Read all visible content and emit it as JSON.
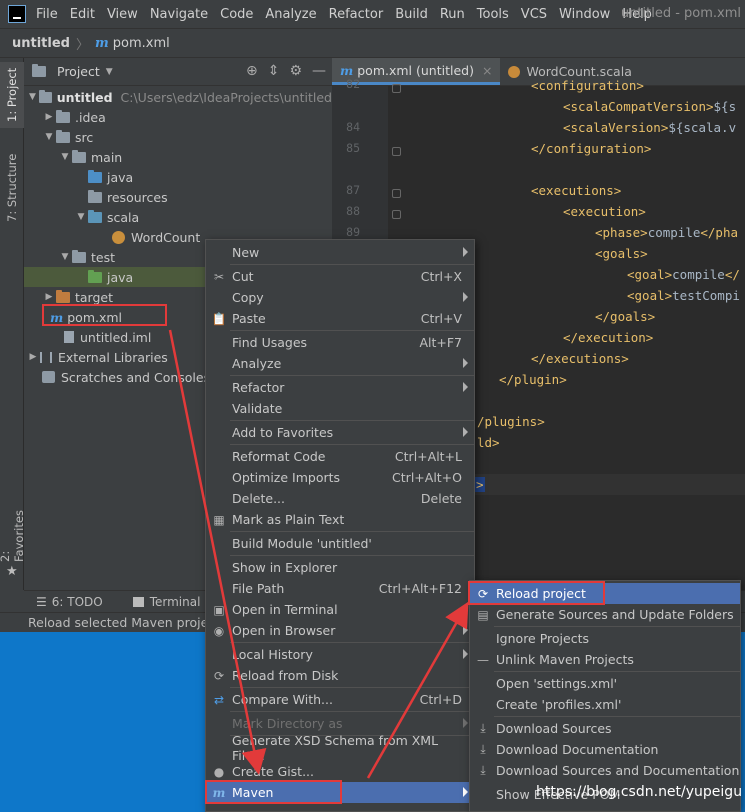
{
  "menubar": {
    "items": [
      "File",
      "Edit",
      "View",
      "Navigate",
      "Code",
      "Analyze",
      "Refactor",
      "Build",
      "Run",
      "Tools",
      "VCS",
      "Window",
      "Help"
    ],
    "window_title": "untitled - pom.xml"
  },
  "breadcrumb": {
    "project": "untitled",
    "file": "pom.xml"
  },
  "left_strip": {
    "project_tab": "1: Project",
    "structure_tab": "7: Structure",
    "favorites_tab": "2: Favorites"
  },
  "project_panel": {
    "title": "Project",
    "tree": {
      "root": "untitled",
      "root_path": "C:\\Users\\edz\\IdeaProjects\\untitled",
      "idea": ".idea",
      "src": "src",
      "main": "main",
      "java": "java",
      "resources": "resources",
      "scala": "scala",
      "wordcount": "WordCount",
      "test": "test",
      "test_java": "java",
      "target": "target",
      "pom": "pom.xml",
      "iml": "untitled.iml",
      "ext_libs": "External Libraries",
      "scratches": "Scratches and Consoles"
    }
  },
  "editor": {
    "tabs": [
      {
        "label": "pom.xml (untitled)"
      },
      {
        "label": "WordCount.scala"
      }
    ],
    "line_numbers": [
      "82",
      "84",
      "85",
      "87",
      "88",
      "89"
    ],
    "code": {
      "l1": "<configuration>",
      "l2_tag": "<scalaCompatVersion>",
      "l2_txt": "${s",
      "l3_tag": "<scalaVersion>",
      "l3_txt": "${scala.v",
      "l4": "</configuration>",
      "l5": "<executions>",
      "l6": "<execution>",
      "l7_tag": "<phase>",
      "l7_txt": "compile",
      "l7_end": "</pha",
      "l8": "<goals>",
      "l9_tag": "<goal>",
      "l9_txt": "compile",
      "l9_end": "</",
      "l10_tag": "<goal>",
      "l10_txt": "testCompi",
      "l11": "</goals>",
      "l12": "</execution>",
      "l13": "</executions>",
      "l14": "</plugin>",
      "l15": "/plugins>",
      "l16": "ld>",
      "l17": ">"
    }
  },
  "bottom_tabs": {
    "todo": "6: TODO",
    "terminal": "Terminal"
  },
  "status_bar": {
    "text": "Reload selected Maven projec"
  },
  "context_menu": {
    "new": "New",
    "cut": "Cut",
    "cut_sc": "Ctrl+X",
    "copy": "Copy",
    "paste": "Paste",
    "paste_sc": "Ctrl+V",
    "find_usages": "Find Usages",
    "find_usages_sc": "Alt+F7",
    "analyze": "Analyze",
    "refactor": "Refactor",
    "validate": "Validate",
    "add_favorites": "Add to Favorites",
    "reformat": "Reformat Code",
    "reformat_sc": "Ctrl+Alt+L",
    "optimize": "Optimize Imports",
    "optimize_sc": "Ctrl+Alt+O",
    "delete": "Delete...",
    "delete_sc": "Delete",
    "plain_text": "Mark as Plain Text",
    "build_module": "Build Module 'untitled'",
    "show_explorer": "Show in Explorer",
    "file_path": "File Path",
    "file_path_sc": "Ctrl+Alt+F12",
    "open_terminal": "Open in Terminal",
    "open_browser": "Open in Browser",
    "local_history": "Local History",
    "reload_disk": "Reload from Disk",
    "compare": "Compare With...",
    "compare_sc": "Ctrl+D",
    "mark_dir": "Mark Directory as",
    "gen_xsd": "Generate XSD Schema from XML File...",
    "gist": "Create Gist...",
    "maven": "Maven"
  },
  "maven_menu": {
    "reload": "Reload project",
    "gen_sources": "Generate Sources and Update Folders",
    "ignore": "Ignore Projects",
    "unlink": "Unlink Maven Projects",
    "open_settings": "Open 'settings.xml'",
    "create_profiles": "Create 'profiles.xml'",
    "dl_sources": "Download Sources",
    "dl_docs": "Download Documentation",
    "dl_both": "Download Sources and Documentation",
    "show_effective": "Show Effective POM"
  },
  "watermark": "https://blog.csdn.net/yupeigu",
  "colors": {
    "accent": "#4b6eaf",
    "annotation": "#e23a3a",
    "desktop": "#0e77c9"
  }
}
